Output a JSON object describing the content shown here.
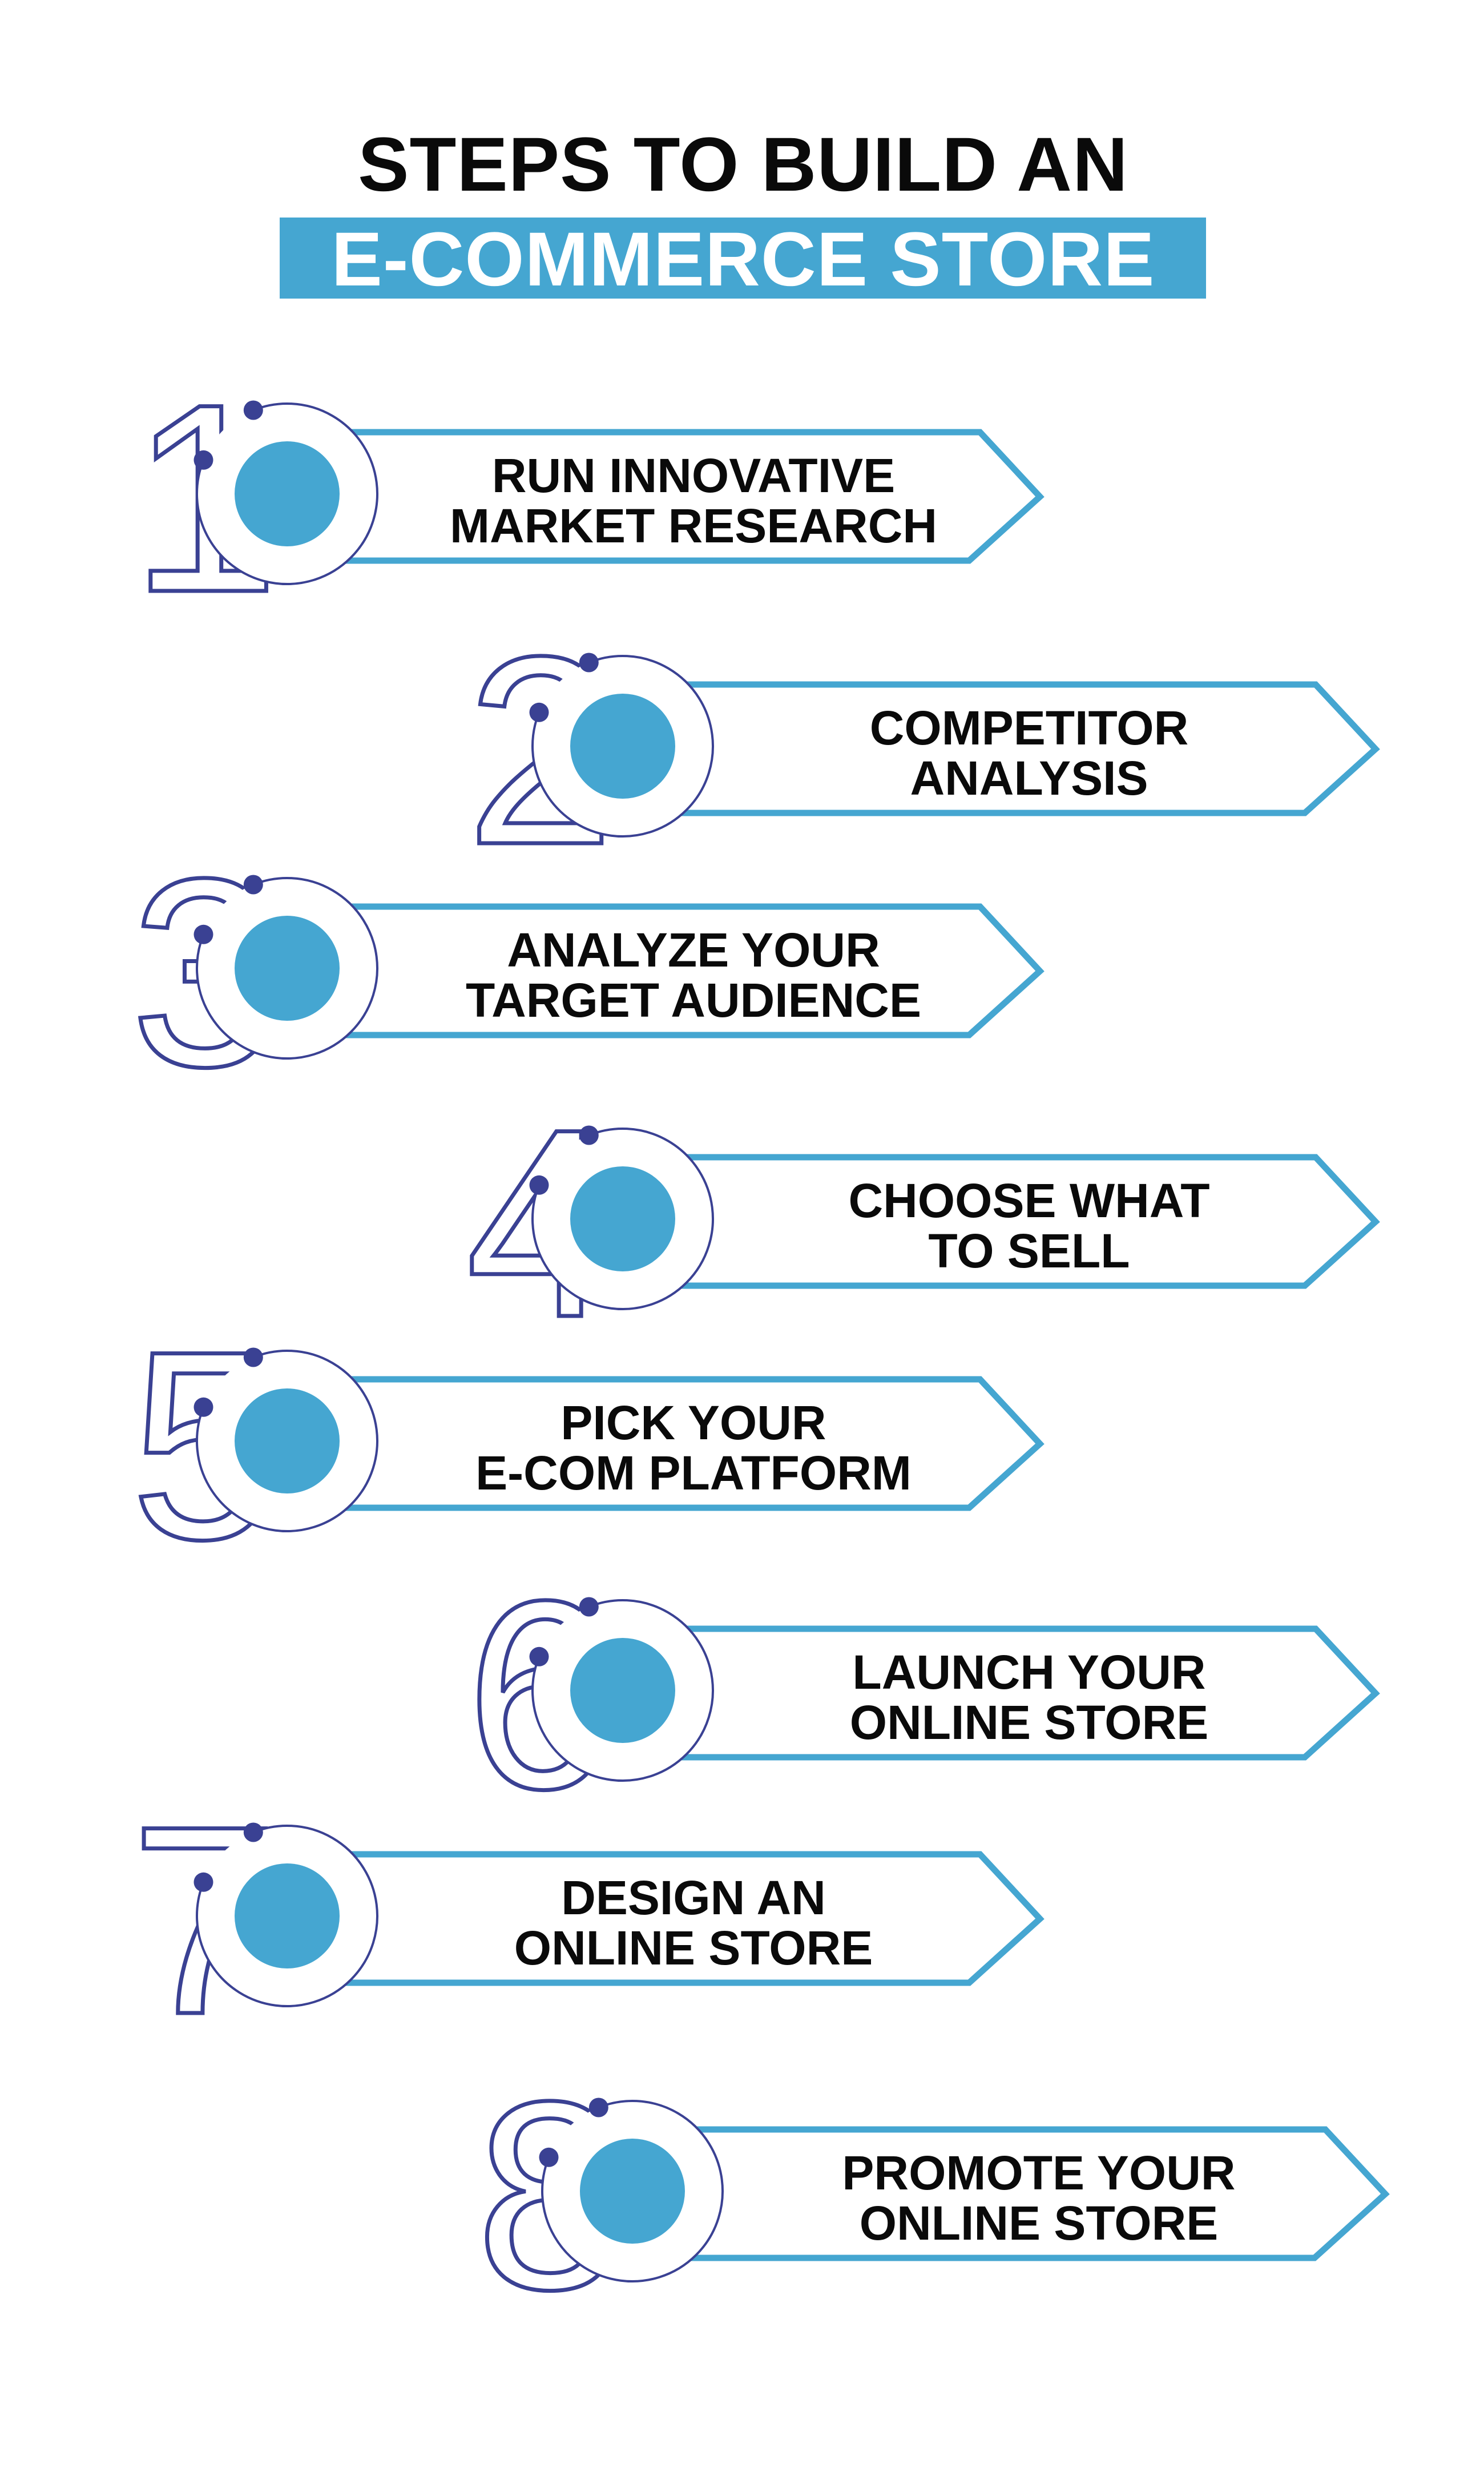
{
  "title": {
    "line1": "STEPS TO BUILD AN",
    "line2": "E-COMMERCE STORE"
  },
  "colors": {
    "accent_blue": "#45a6d1",
    "navy": "#3a4193",
    "text": "#0a0a0a",
    "background": "#ffffff"
  },
  "steps": [
    {
      "number": "1",
      "lines": [
        "RUN INNOVATIVE",
        "MARKET RESEARCH"
      ]
    },
    {
      "number": "2",
      "lines": [
        "COMPETITOR",
        "ANALYSIS"
      ]
    },
    {
      "number": "3",
      "lines": [
        "ANALYZE YOUR",
        "TARGET AUDIENCE"
      ]
    },
    {
      "number": "4",
      "lines": [
        "CHOOSE WHAT",
        "TO SELL"
      ]
    },
    {
      "number": "5",
      "lines": [
        "PICK YOUR",
        "E-COM PLATFORM"
      ]
    },
    {
      "number": "6",
      "lines": [
        "LAUNCH YOUR",
        "ONLINE STORE"
      ]
    },
    {
      "number": "7",
      "lines": [
        "DESIGN AN",
        "ONLINE STORE"
      ]
    },
    {
      "number": "8",
      "lines": [
        "PROMOTE YOUR",
        "ONLINE STORE"
      ]
    }
  ]
}
